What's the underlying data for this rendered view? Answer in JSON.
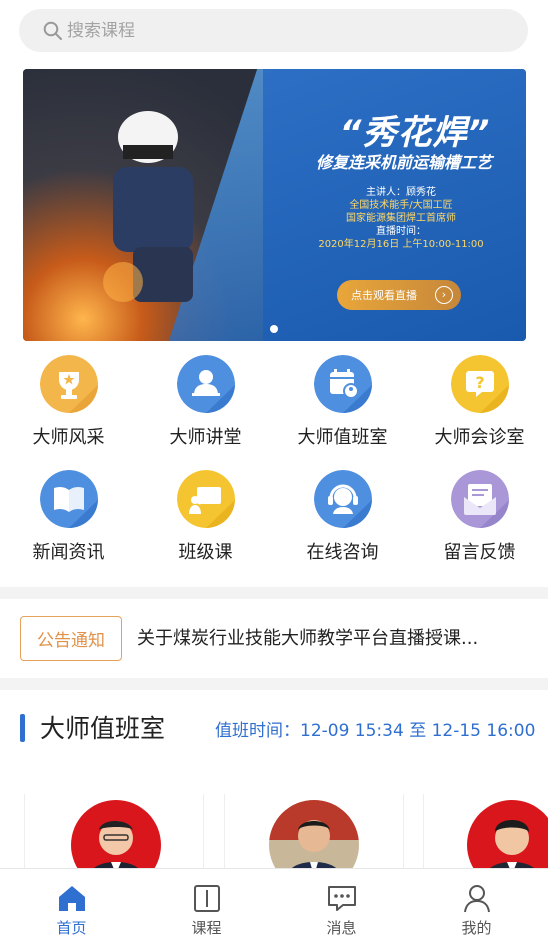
{
  "search": {
    "placeholder": "搜索课程",
    "icon": "search-icon"
  },
  "banner": {
    "title": "“秀花焊”",
    "subtitle": "修复连采机前运输槽工艺",
    "speaker_label": "主讲人：顾秀花",
    "line1": "全国技术能手/大国工匠",
    "line2": "国家能源集团焊工首席师",
    "time_label": "直播时间：",
    "time_value": "2020年12月16日 上午10:00-11:00",
    "button": "点击观看直播"
  },
  "grid": [
    {
      "label": "大师风采",
      "icon": "trophy-icon"
    },
    {
      "label": "大师讲堂",
      "icon": "lecturer-icon"
    },
    {
      "label": "大师值班室",
      "icon": "calendar-user-icon"
    },
    {
      "label": "大师会诊室",
      "icon": "question-icon"
    },
    {
      "label": "新闻资讯",
      "icon": "book-icon"
    },
    {
      "label": "班级课",
      "icon": "classroom-icon"
    },
    {
      "label": "在线咨询",
      "icon": "headset-icon"
    },
    {
      "label": "留言反馈",
      "icon": "mail-icon"
    }
  ],
  "notice": {
    "tag": "公告通知",
    "text": "关于煤炭行业技能大师教学平台直播授课..."
  },
  "duty": {
    "title": "大师值班室",
    "time": "值班时间：12-09 15:34 至 12-15 16:00"
  },
  "tabs": [
    {
      "label": "首页",
      "icon": "home-icon"
    },
    {
      "label": "课程",
      "icon": "course-book-icon"
    },
    {
      "label": "消息",
      "icon": "message-icon"
    },
    {
      "label": "我的",
      "icon": "profile-icon"
    }
  ],
  "colors": {
    "accent": "#2f6fd0",
    "notice": "#e0924a"
  }
}
